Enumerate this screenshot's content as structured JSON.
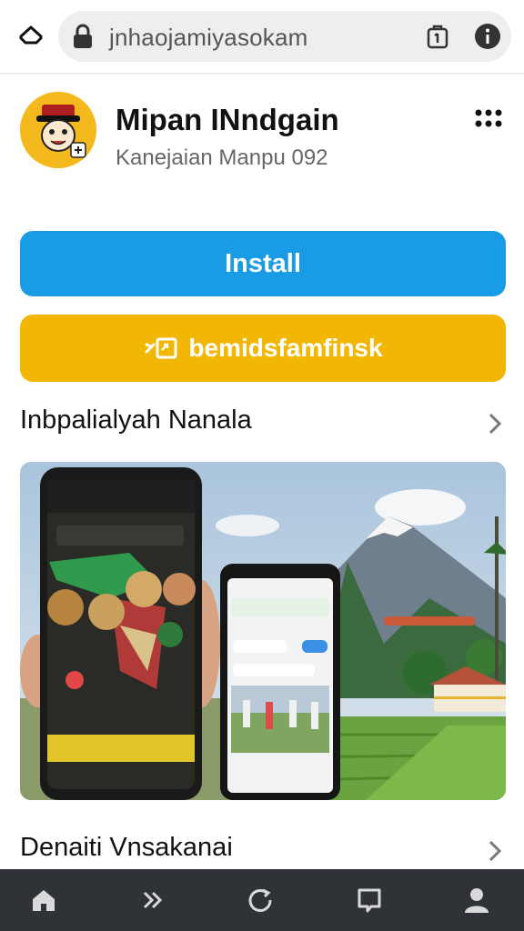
{
  "browser": {
    "url": "jnhaojamiyasokam",
    "icons": [
      "home-icon",
      "lock-icon",
      "tabs-icon",
      "info-icon"
    ]
  },
  "app": {
    "title": "Mipan INndgain",
    "subtitle": "Kanejaian Manpu 092",
    "install_label": "Install",
    "secondary_label": "bemidsfamfinsk"
  },
  "sections": [
    {
      "title": "Inbpalialyah Nanala"
    },
    {
      "title": "Denaiti Vnsakanai"
    }
  ],
  "colors": {
    "install": "#1a9be6",
    "secondary": "#f2b705",
    "navbar": "#2f3338"
  },
  "navbar": {
    "icons": [
      "home-icon",
      "forward-icon",
      "refresh-icon",
      "tabs-icon",
      "profile-icon"
    ]
  }
}
